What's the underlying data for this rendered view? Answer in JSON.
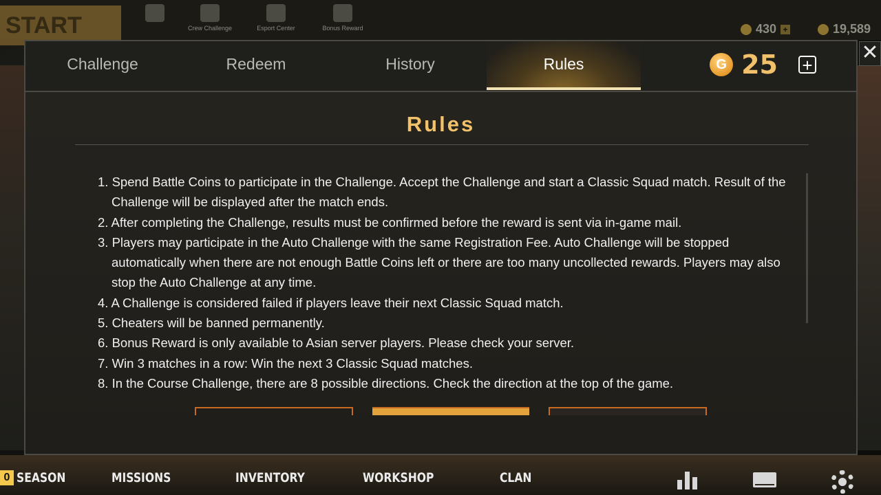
{
  "background": {
    "start_label": "START",
    "top_icons": [
      {
        "icon": "grid-icon",
        "label": ""
      },
      {
        "icon": "flag-icon",
        "label": "Crew Challenge"
      },
      {
        "icon": "cloud-icon",
        "label": "Esport Center"
      },
      {
        "icon": "bag-icon",
        "label": "Bonus Reward"
      }
    ],
    "currency_1": "430",
    "currency_2": "19,589"
  },
  "tabs": [
    {
      "label": "Challenge",
      "active": false
    },
    {
      "label": "Redeem",
      "active": false
    },
    {
      "label": "History",
      "active": false
    },
    {
      "label": "Rules",
      "active": true
    }
  ],
  "currency": {
    "icon": "g-coin-icon",
    "glyph": "G",
    "amount": "25",
    "add_symbol": "+"
  },
  "close_symbol": "✕",
  "rules": {
    "title": "Rules",
    "items": [
      "1. Spend Battle Coins to participate in the Challenge. Accept the Challenge and start a Classic Squad match. Result of the Challenge will be displayed after the match ends.",
      "2. After completing the Challenge, results must be confirmed before the reward is sent via in-game mail.",
      "3. Players may participate in the Auto Challenge with the same Registration Fee. Auto Challenge will be stopped automatically when there are not enough Battle Coins left or there are too many uncollected rewards. Players may also stop the Auto Challenge at any time.",
      "4. A Challenge is considered failed if players leave their next Classic Squad match.",
      "5. Cheaters will be banned permanently.",
      "6. Bonus Reward is only available to Asian server players. Please check your server.",
      "7. Win 3 matches in a row: Win the next 3 Classic Squad matches.",
      "8. In the Course Challenge, there are 8 possible directions. Check the direction at the top of the game."
    ]
  },
  "bottom_nav": {
    "season_badge": "0",
    "items": [
      "SEASON",
      "MISSIONS",
      "INVENTORY",
      "WORKSHOP",
      "CLAN"
    ],
    "icons": [
      "stats-icon",
      "mail-icon",
      "settings-icon"
    ]
  }
}
